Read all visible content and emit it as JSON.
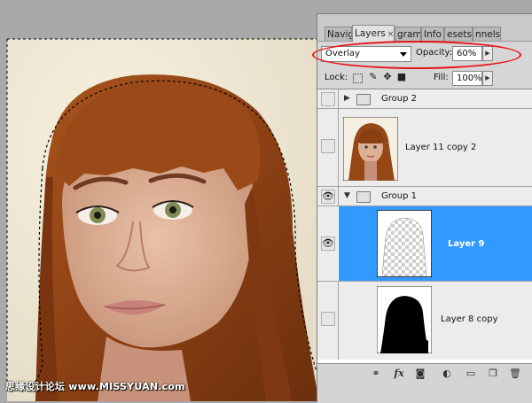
{
  "watermark": "思缘设计论坛 www.MISSYUAN.com",
  "panel": {
    "tabs": [
      {
        "label": "Navig",
        "active": false
      },
      {
        "label": "Layers",
        "active": true
      },
      {
        "label": "gram",
        "active": false
      },
      {
        "label": "Info",
        "active": false
      },
      {
        "label": "esets",
        "active": false
      },
      {
        "label": "nnels",
        "active": false
      }
    ],
    "close_glyph": "×",
    "blend_mode": "Overlay",
    "opacity_label": "Opacity:",
    "opacity_value": "60%",
    "lock_label": "Lock:",
    "fill_label": "Fill:",
    "fill_value": "100%",
    "layers": [
      {
        "name": "Group 2",
        "kind": "group",
        "expanded": false,
        "visible": false
      },
      {
        "name": "Layer 11 copy 2",
        "kind": "layer",
        "visible": false
      },
      {
        "name": "Group 1",
        "kind": "group",
        "expanded": true,
        "visible": true
      },
      {
        "name": "Layer 9",
        "kind": "layer",
        "visible": true,
        "selected": true
      },
      {
        "name": "Layer 8 copy",
        "kind": "layer",
        "visible": false
      }
    ]
  },
  "colors": {
    "selection": "#3299ff",
    "highlight_ellipse": "#e8141c",
    "panel_bg": "#d6d6d6"
  }
}
